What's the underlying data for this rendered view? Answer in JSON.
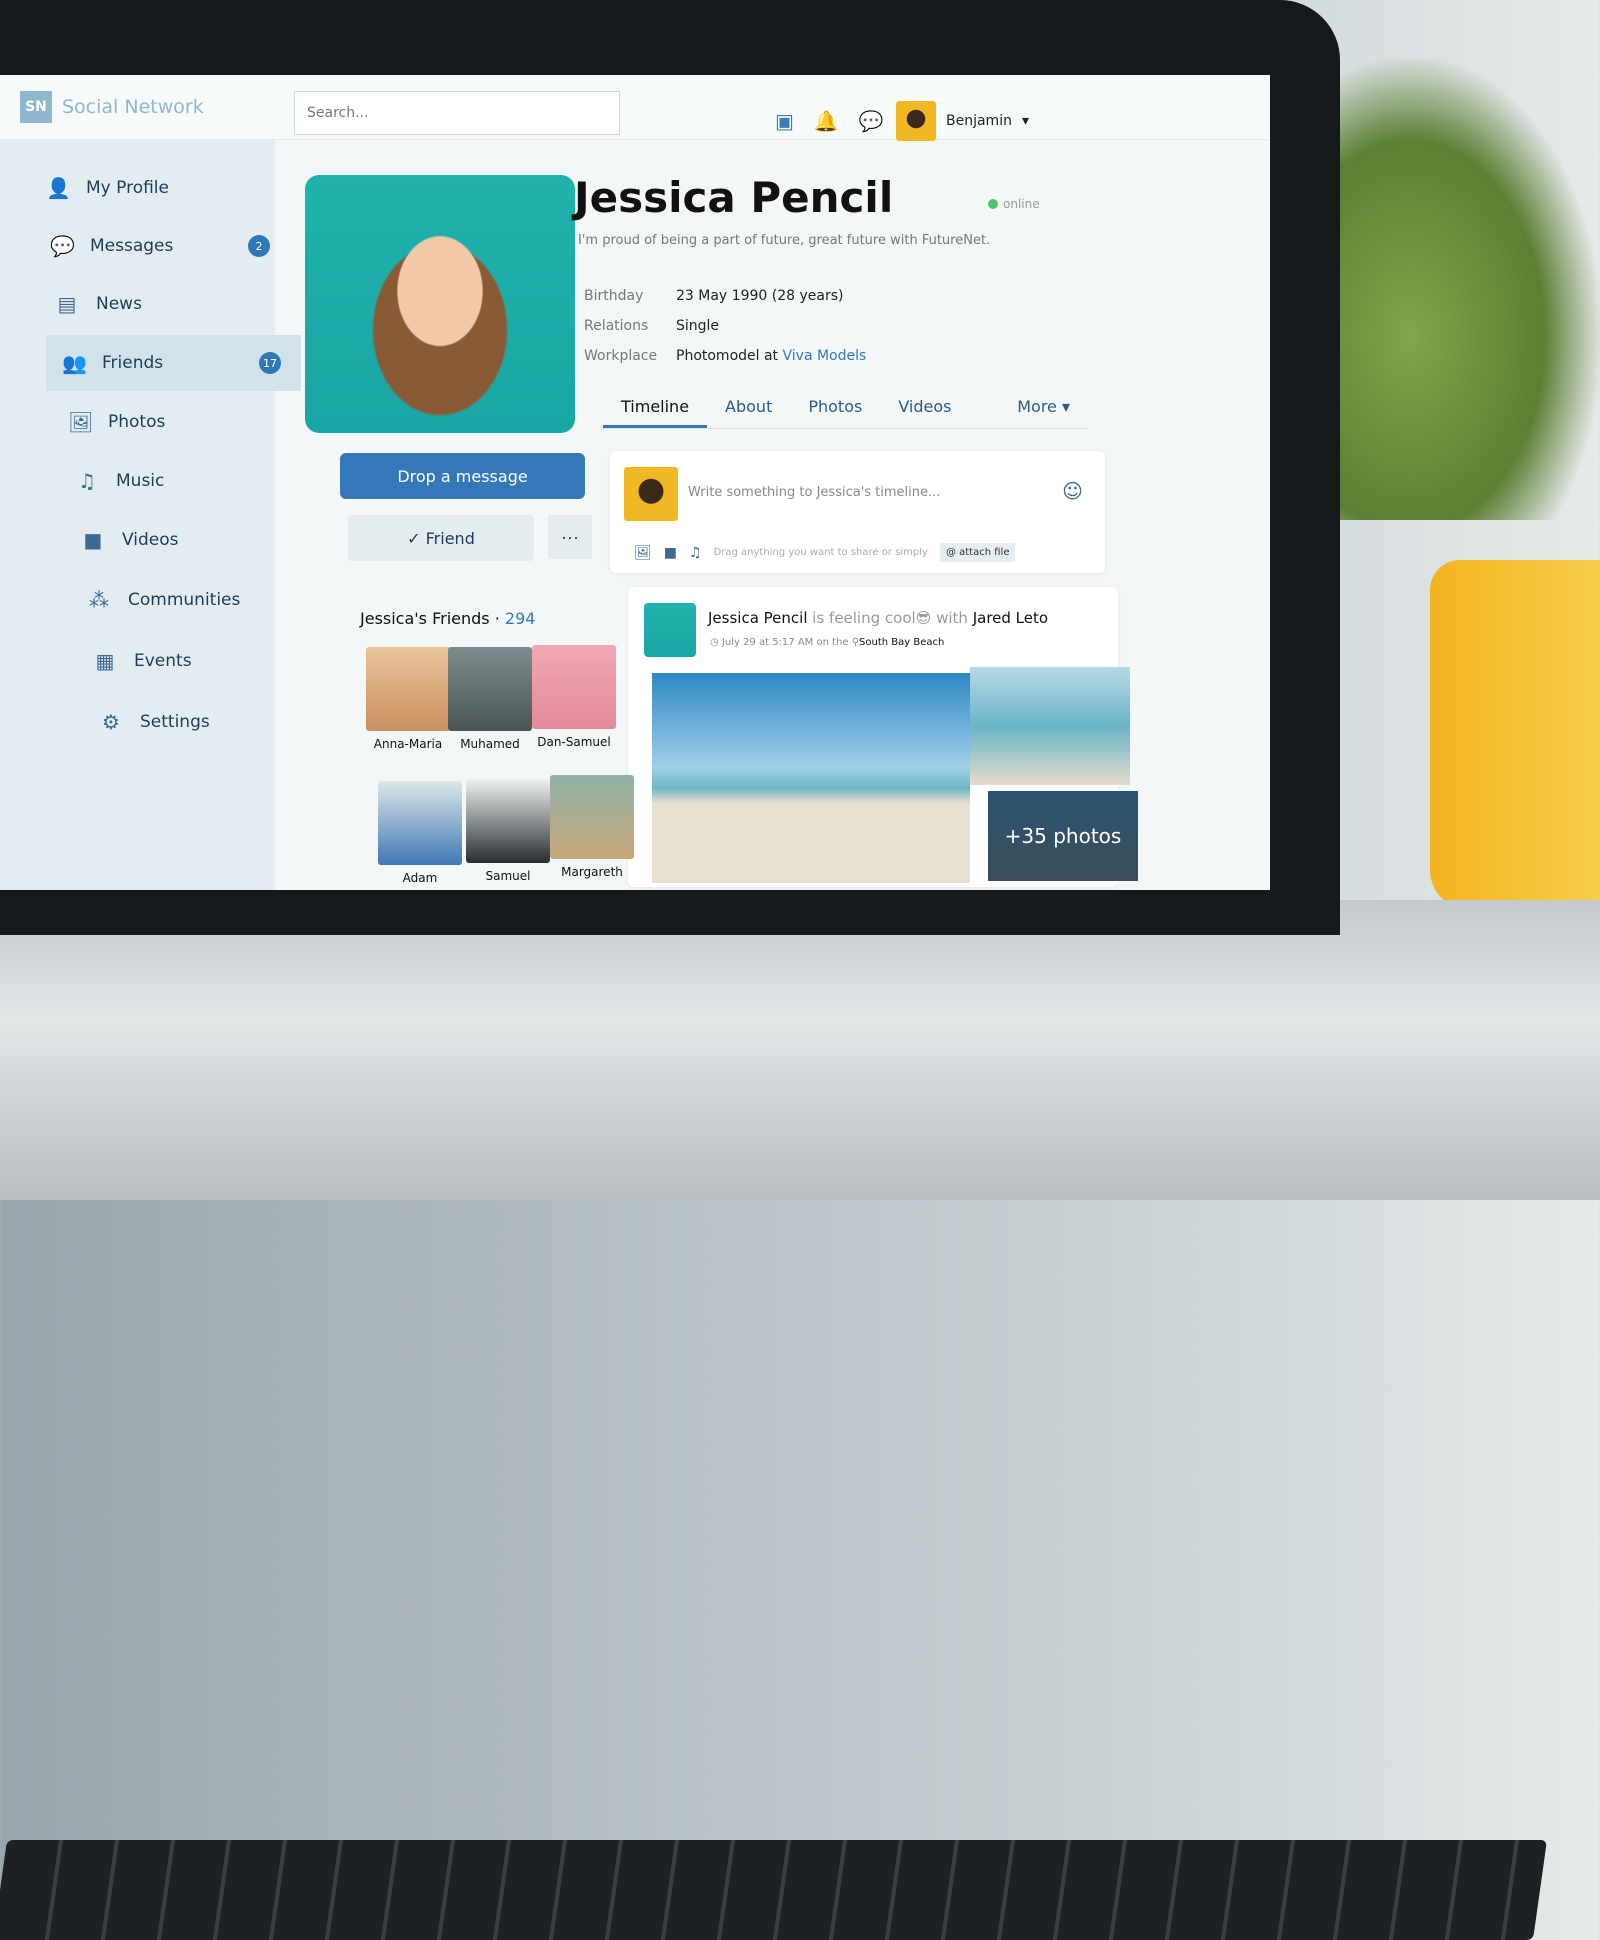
{
  "app": {
    "logo_mark": "SN",
    "title": "Social Network"
  },
  "search": {
    "placeholder": "Search..."
  },
  "header": {
    "icons": [
      "wallet-icon",
      "bell-icon",
      "chat-icon"
    ],
    "user": "Benjamin"
  },
  "sidebar": {
    "items": [
      {
        "label": "My Profile",
        "icon": "👤"
      },
      {
        "label": "Messages",
        "icon": "💬",
        "badge": "2"
      },
      {
        "label": "News",
        "icon": "▤"
      },
      {
        "label": "Friends",
        "icon": "👥",
        "badge": "17",
        "active": true
      },
      {
        "label": "Photos",
        "icon": "🖼"
      },
      {
        "label": "Music",
        "icon": "♫"
      },
      {
        "label": "Videos",
        "icon": "■"
      },
      {
        "label": "Communities",
        "icon": "⁂"
      },
      {
        "label": "Events",
        "icon": "▦"
      },
      {
        "label": "Settings",
        "icon": "⚙"
      }
    ]
  },
  "profile": {
    "name": "Jessica Pencil",
    "status": "online",
    "bio": "I'm proud of being a part of future, great future with FutureNet.",
    "birthday_label": "Birthday",
    "birthday": "23 May 1990 (28 years)",
    "relations_label": "Relations",
    "relations": "Single",
    "workplace_label": "Workplace",
    "workplace": "Photomodel at",
    "workplace_link": "Viva Models"
  },
  "actions": {
    "message": "Drop a message",
    "friend": "Friend",
    "more": "···"
  },
  "tabs": [
    "Timeline",
    "About",
    "Photos",
    "Videos",
    "More ▾"
  ],
  "composer": {
    "placeholder": "Write something to Jessica's timeline...",
    "hint": "Drag anything you want to share or simply",
    "attach": "attach file"
  },
  "post": {
    "author": "Jessica Pencil",
    "feeling": "is feeling cool😎",
    "with": "with",
    "tagged": "Jared Leto",
    "time": "July 29 at 5:17 AM on the",
    "place": "South Bay Beach",
    "more_photos": "+35 photos"
  },
  "friends": {
    "title": "Jessica's Friends ·",
    "count": "294",
    "list": [
      "Anna-Maria",
      "Muhamed",
      "Dan-Samuel",
      "Adam",
      "Samuel",
      "Margareth"
    ]
  },
  "colors": {
    "accent": "#3578ba",
    "sidebar": "#e3edf1",
    "online": "#4cc46a"
  }
}
